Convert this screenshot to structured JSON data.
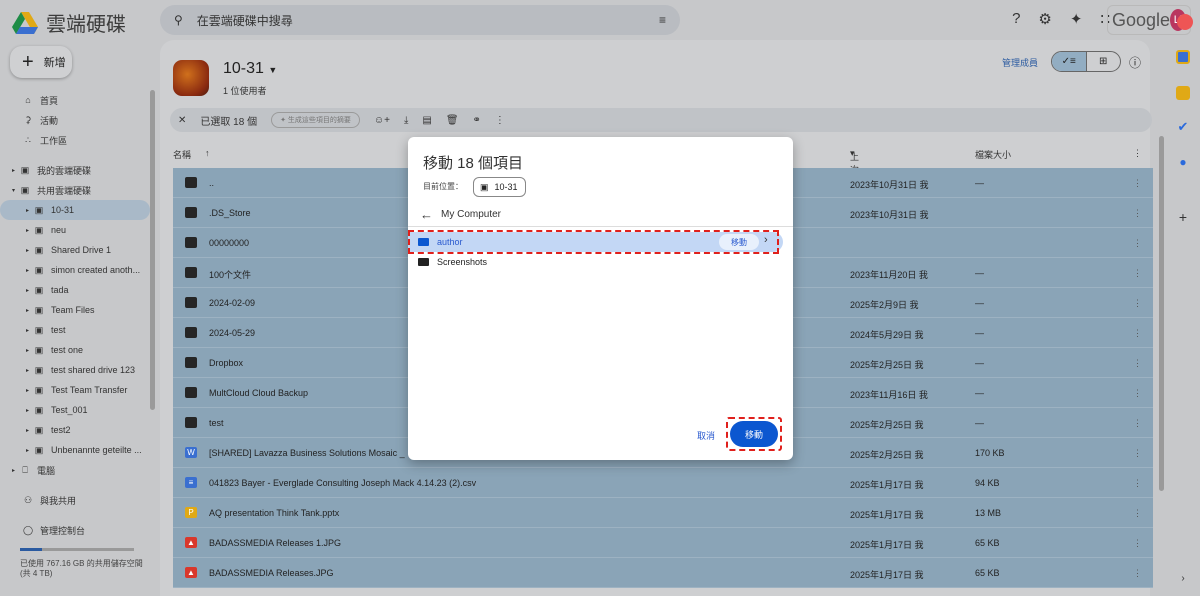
{
  "app": {
    "title": "雲端硬碟",
    "search_placeholder": "在雲端硬碟中搜尋",
    "brand": "Google",
    "avatar": "Li"
  },
  "sidebar": {
    "new_label": "新增",
    "items": [
      {
        "label": "首頁",
        "icon": "home-icon"
      },
      {
        "label": "活動",
        "icon": "bell-icon"
      },
      {
        "label": "工作區",
        "icon": "workspace-icon"
      }
    ],
    "drives": [
      {
        "label": "我的雲端硬碟"
      },
      {
        "label": "共用雲端硬碟"
      }
    ],
    "shared": [
      "10-31",
      "neu",
      "Shared Drive 1",
      "simon created anoth...",
      "tada",
      "Team Files",
      "test",
      "test one",
      "test shared drive 123",
      "Test Team Transfer",
      "Test_001",
      "test2",
      "Unbenannte geteilte ..."
    ],
    "computers": "電腦",
    "shared_with_me": "與我共用",
    "admin": "管理控制台",
    "storage_text": "已使用 767.16 GB 的共用儲存空間",
    "storage_total": "(共 4 TB)",
    "storage_fraction": 0.19
  },
  "header": {
    "drive_name": "10-31",
    "members": "1 位使用者",
    "manage_members": "管理成員"
  },
  "selection": {
    "count_label": "已選取 18 個",
    "summary_label": "生成這些項目的摘要"
  },
  "table": {
    "col_name": "名稱",
    "col_modified": "上次修改時間",
    "col_size": "檔案大小",
    "rows": [
      {
        "name": "..",
        "type": "folder",
        "modified": "2023年10月31日 我",
        "size": "—"
      },
      {
        "name": ".DS_Store",
        "type": "folder",
        "modified": "2023年10月31日 我",
        "size": ""
      },
      {
        "name": "00000000",
        "type": "shortcut",
        "modified": "",
        "size": ""
      },
      {
        "name": "100个文件",
        "type": "folder",
        "modified": "2023年11月20日 我",
        "size": "—"
      },
      {
        "name": "2024-02-09",
        "type": "folder",
        "modified": "2025年2月9日 我",
        "size": "—"
      },
      {
        "name": "2024-05-29",
        "type": "folder",
        "modified": "2024年5月29日 我",
        "size": "—"
      },
      {
        "name": "Dropbox",
        "type": "folder",
        "modified": "2025年2月25日 我",
        "size": "—"
      },
      {
        "name": "MultCloud Cloud Backup",
        "type": "folder",
        "modified": "2023年11月16日 我",
        "size": "—"
      },
      {
        "name": "test",
        "type": "folder",
        "modified": "2025年2月25日 我",
        "size": "—"
      },
      {
        "name": "[SHARED] Lavazza Business Solutions Mosaic _",
        "type": "word",
        "modified": "2025年2月25日 我",
        "size": "170 KB"
      },
      {
        "name": "041823 Bayer - Everglade Consulting  Joseph Mack  4.14.23 (2).csv",
        "type": "doc",
        "modified": "2025年1月17日 我",
        "size": "94 KB"
      },
      {
        "name": "AQ presentation Think Tank.pptx",
        "type": "slides",
        "modified": "2025年1月17日 我",
        "size": "13 MB"
      },
      {
        "name": "BADASSMEDIA Releases 1.JPG",
        "type": "image",
        "modified": "2025年1月17日 我",
        "size": "65 KB"
      },
      {
        "name": "BADASSMEDIA Releases.JPG",
        "type": "image",
        "modified": "2025年1月17日 我",
        "size": "65 KB"
      }
    ]
  },
  "dialog": {
    "title": "移動 18 個項目",
    "location_label": "目前位置：",
    "location": "10-31",
    "back_label": "My Computer",
    "folders": [
      {
        "name": "author",
        "move": "移動"
      },
      {
        "name": "Screenshots"
      }
    ],
    "cancel": "取消",
    "move": "移動"
  },
  "colors": {
    "accent": "#0b57d0",
    "highlight": "#c3d7f5",
    "selected_row": "#8aa4b7",
    "annotation": "#e0201c"
  }
}
